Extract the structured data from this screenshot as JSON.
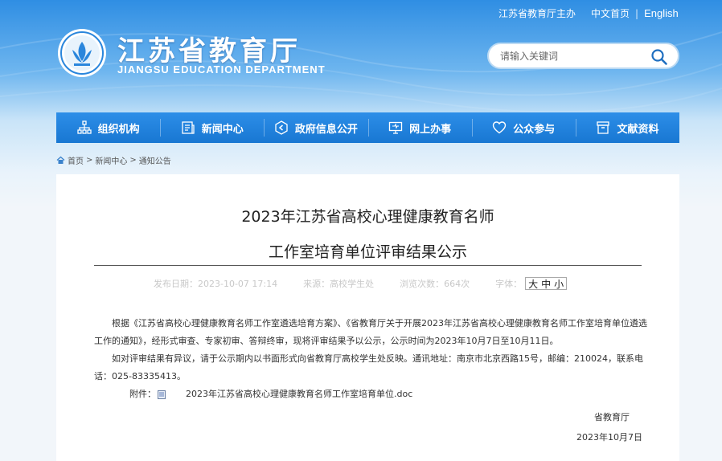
{
  "header": {
    "host_text": "江苏省教育厅主办",
    "lang_cn": "中文首页",
    "lang_sep": "|",
    "lang_en": "English",
    "brand_cn": "江苏省教育厅",
    "brand_en": "JIANGSU EDUCATION DEPARTMENT",
    "search_placeholder": "请输入关键词"
  },
  "nav": {
    "items": [
      {
        "label": "组织机构",
        "icon": "org-chart-icon"
      },
      {
        "label": "新闻中心",
        "icon": "news-icon"
      },
      {
        "label": "政府信息公开",
        "icon": "info-disclosure-icon"
      },
      {
        "label": "网上办事",
        "icon": "monitor-icon"
      },
      {
        "label": "公众参与",
        "icon": "heart-icon"
      },
      {
        "label": "文献资料",
        "icon": "archive-icon"
      }
    ]
  },
  "breadcrumb": {
    "home": "首页",
    "sep": ">",
    "level1": "新闻中心",
    "level2": "通知公告"
  },
  "article": {
    "title_line1": "2023年江苏省高校心理健康教育名师",
    "title_line2": "工作室培育单位评审结果公示",
    "meta": {
      "date_label": "发布日期：",
      "date": "2023-10-07 17:14",
      "source_label": "来源：",
      "source": "高校学生处",
      "views_label": "浏览次数：",
      "views": "664次",
      "font_label": "字体：",
      "font_large": "大",
      "font_medium": "中",
      "font_small": "小"
    },
    "para1": "根据《江苏省高校心理健康教育名师工作室遴选培育方案》、《省教育厅关于开展2023年江苏省高校心理健康教育名师工作室培育单位遴选工作的通知》，经形式审查、专家初审、答辩终审，现将评审结果予以公示，公示时间为2023年10月7日至10月11日。",
    "para2": "如对评审结果有异议，请于公示期内以书面形式向省教育厅高校学生处反映。通讯地址：南京市北京西路15号，邮编：210024，联系电话：025-83335413。",
    "attach_label": "附件：",
    "attach_file": "2023年江苏省高校心理健康教育名师工作室培育单位.doc",
    "sign_org": "省教育厅",
    "sign_date": "2023年10月7日"
  },
  "colors": {
    "nav_bg": "#1877d2",
    "header_bg": "#2f8ee3"
  }
}
